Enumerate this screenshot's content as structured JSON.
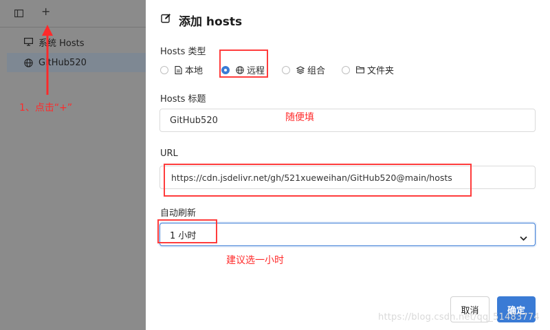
{
  "sidebar": {
    "toolbar": {
      "add_label": "+"
    },
    "items": [
      {
        "label": "系统 Hosts",
        "icon": "monitor-icon"
      },
      {
        "label": "GitHub520",
        "icon": "globe-icon"
      }
    ]
  },
  "annotations": {
    "step1": "1、点击“+”",
    "title_hint": "随便填",
    "refresh_hint": "建议选一小时"
  },
  "modal": {
    "title": "添加 hosts",
    "type_section": {
      "label": "Hosts 类型",
      "options": [
        {
          "label": "本地",
          "icon": "file-icon",
          "selected": false
        },
        {
          "label": "远程",
          "icon": "globe-icon",
          "selected": true
        },
        {
          "label": "组合",
          "icon": "layers-icon",
          "selected": false
        },
        {
          "label": "文件夹",
          "icon": "folder-icon",
          "selected": false
        }
      ]
    },
    "title_field": {
      "label": "Hosts 标题",
      "value": "GitHub520"
    },
    "url_field": {
      "label": "URL",
      "value": "https://cdn.jsdelivr.net/gh/521xueweihan/GitHub520@main/hosts"
    },
    "refresh_field": {
      "label": "自动刷新",
      "value": "1 小时"
    },
    "buttons": {
      "cancel": "取消",
      "ok": "确定"
    }
  },
  "watermark": "https://blog.csdn.net/qq_51483774",
  "colors": {
    "accent": "#3a7bd5",
    "annotation": "#ff2a2a",
    "overlay": "#8b8b8b"
  }
}
